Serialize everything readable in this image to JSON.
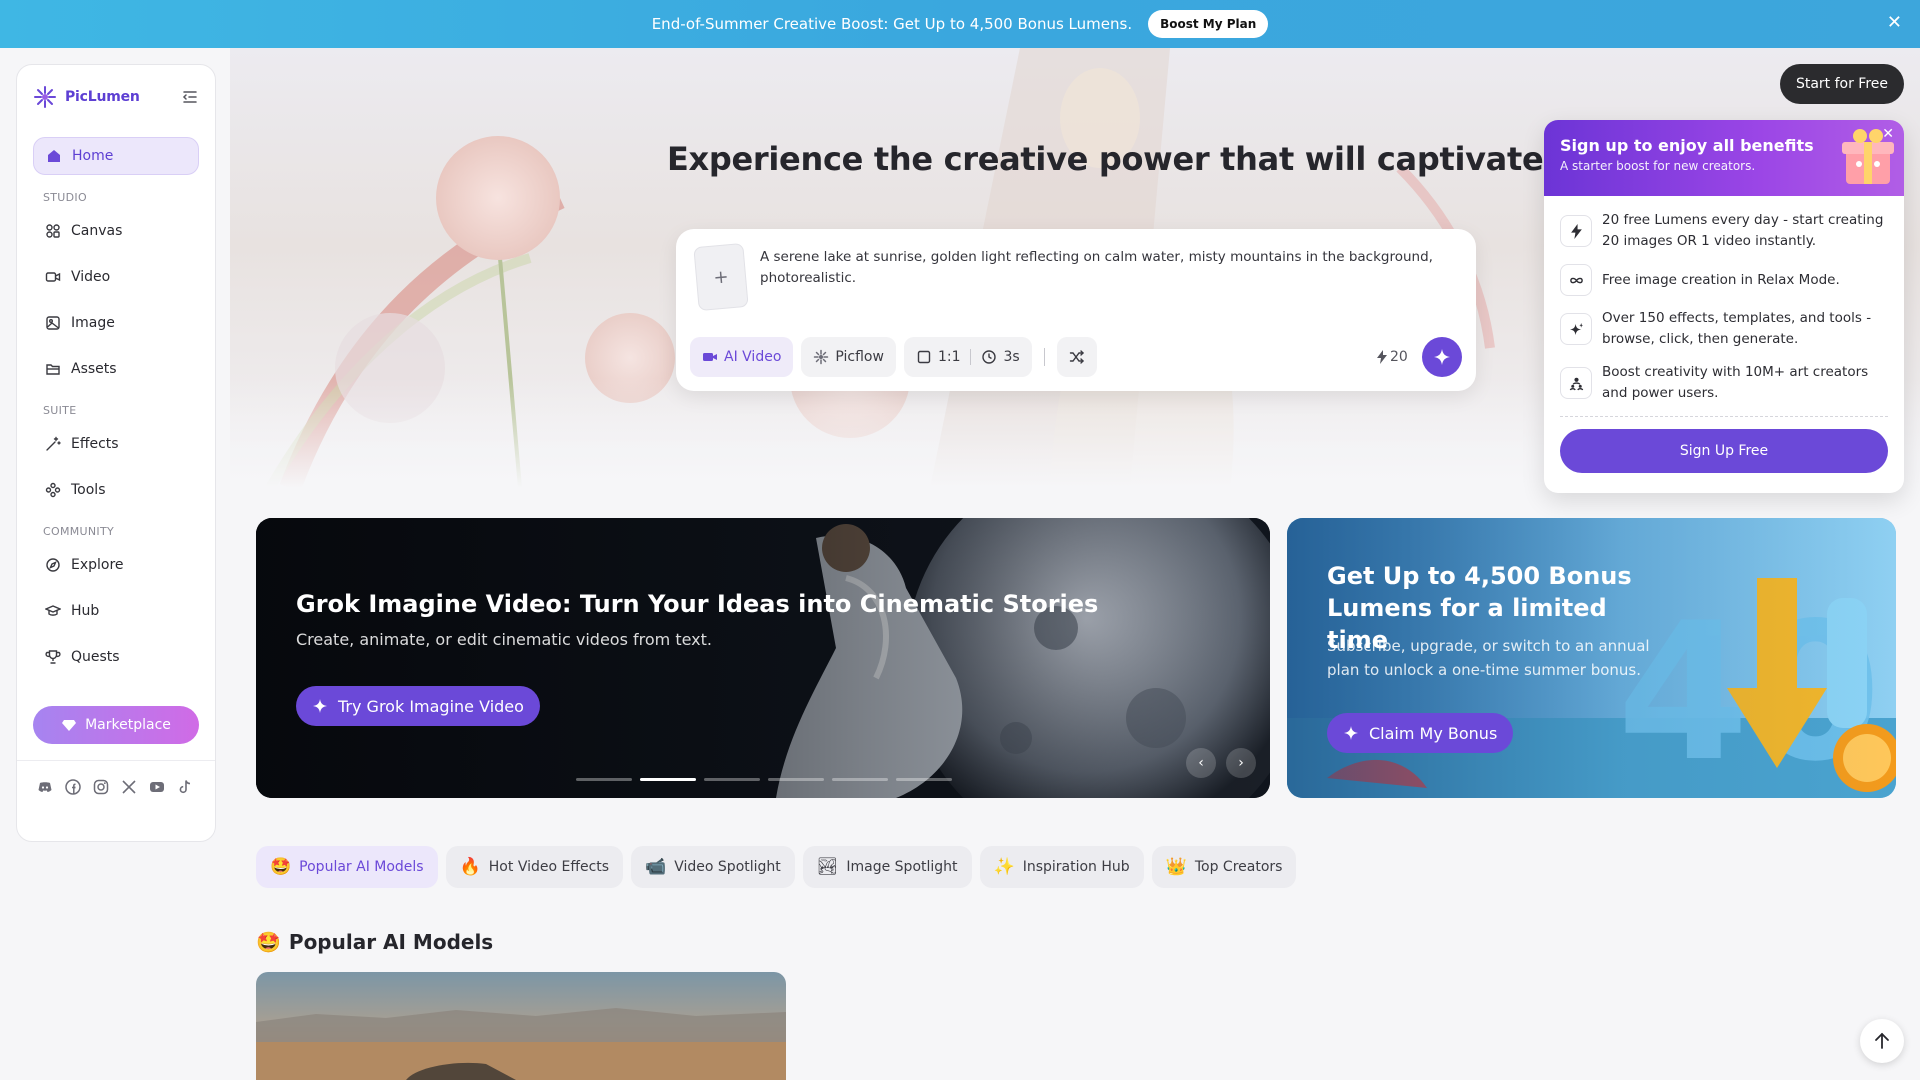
{
  "promo": {
    "text": "End-of-Summer Creative Boost: Get Up to 4,500 Bonus Lumens.",
    "button": "Boost My Plan"
  },
  "brand": {
    "name": "PicLumen"
  },
  "sidebar": {
    "home": "Home",
    "studio_label": "STUDIO",
    "studio": [
      "Canvas",
      "Video",
      "Image",
      "Assets"
    ],
    "suite_label": "SUITE",
    "suite": [
      "Effects",
      "Tools"
    ],
    "community_label": "COMMUNITY",
    "community": [
      "Explore",
      "Hub",
      "Quests"
    ],
    "marketplace": "Marketplace"
  },
  "header": {
    "start_button": "Start for Free"
  },
  "hero": {
    "title": "Experience the creative power that will captivate you",
    "prompt_text": "A serene lake at sunrise, golden light reflecting on calm water, misty mountains in the background, photorealistic.",
    "add_symbol": "+",
    "chips": {
      "mode": "AI Video",
      "model": "Picflow",
      "ratio": "1:1",
      "duration": "3s"
    },
    "credits": "20"
  },
  "signup": {
    "title": "Sign up to enjoy all benefits",
    "subtitle": "A starter boost for new creators.",
    "benefits": [
      "20 free Lumens every day - start creating 20 images OR 1 video instantly.",
      "Free image creation in Relax Mode.",
      "Over 150 effects, templates, and tools - browse, click, then generate.",
      "Boost creativity with 10M+ art creators and power users."
    ],
    "button": "Sign Up Free"
  },
  "banner1": {
    "title": "Grok Imagine Video: Turn Your Ideas into Cinematic Stories",
    "subtitle": "Create, animate, or edit cinematic videos from text.",
    "button": "Try Grok Imagine Video",
    "slides": 6,
    "active_slide": 2
  },
  "banner2": {
    "title": "Get Up to 4,500 Bonus Lumens for a limited time",
    "subtitle": "Subscribe, upgrade, or switch to an annual plan to unlock a one-time summer bonus.",
    "button": "Claim My Bonus"
  },
  "tabs": [
    {
      "emoji": "🤩",
      "label": "Popular AI Models"
    },
    {
      "emoji": "🔥",
      "label": "Hot Video Effects"
    },
    {
      "emoji": "📹",
      "label": "Video Spotlight"
    },
    {
      "emoji": "🏞",
      "label": "Image Spotlight"
    },
    {
      "emoji": "✨",
      "label": "Inspiration Hub"
    },
    {
      "emoji": "👑",
      "label": "Top Creators"
    }
  ],
  "section": {
    "emoji": "🤩",
    "title": "Popular AI Models"
  },
  "colors": {
    "accent": "#6b49d8",
    "banner": "#3fb7e4"
  }
}
